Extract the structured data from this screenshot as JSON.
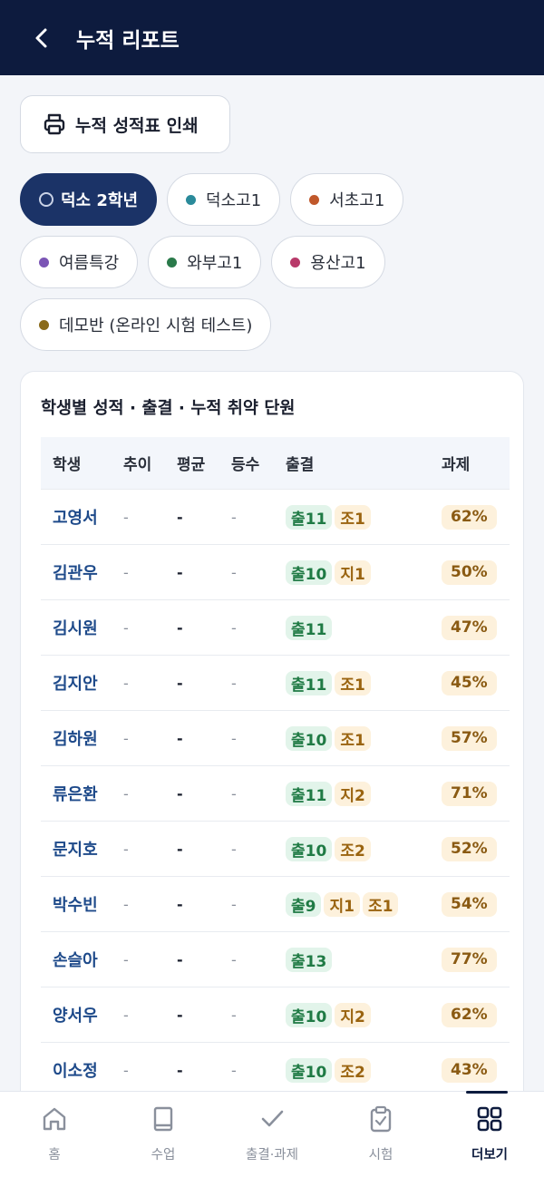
{
  "header": {
    "title": "누적 리포트"
  },
  "print_button": {
    "label": "누적 성적표 인쇄"
  },
  "classes": [
    {
      "label": "덕소 2학년",
      "active": true,
      "color": "#c9d2e6"
    },
    {
      "label": "덕소고1",
      "active": false,
      "color": "#2a8a9a"
    },
    {
      "label": "서초고1",
      "active": false,
      "color": "#c0582b"
    },
    {
      "label": "여름특강",
      "active": false,
      "color": "#7b55b5"
    },
    {
      "label": "와부고1",
      "active": false,
      "color": "#2a7a4a"
    },
    {
      "label": "용산고1",
      "active": false,
      "color": "#b83a6a"
    },
    {
      "label": "데모반 (온라인 시험 테스트)",
      "active": false,
      "color": "#8a6a1a"
    }
  ],
  "report": {
    "title": "학생별 성적 · 출결 · 누적 취약 단원",
    "columns": {
      "student": "학생",
      "trend": "추이",
      "avg": "평균",
      "rank": "등수",
      "attendance": "출결",
      "homework": "과제"
    },
    "rows": [
      {
        "name": "고영서",
        "trend": "-",
        "avg": "-",
        "rank": "-",
        "att": [
          "출11",
          "조1"
        ],
        "hw": "62%"
      },
      {
        "name": "김관우",
        "trend": "-",
        "avg": "-",
        "rank": "-",
        "att": [
          "출10",
          "지1"
        ],
        "hw": "50%"
      },
      {
        "name": "김시원",
        "trend": "-",
        "avg": "-",
        "rank": "-",
        "att": [
          "출11"
        ],
        "hw": "47%"
      },
      {
        "name": "김지안",
        "trend": "-",
        "avg": "-",
        "rank": "-",
        "att": [
          "출11",
          "조1"
        ],
        "hw": "45%"
      },
      {
        "name": "김하원",
        "trend": "-",
        "avg": "-",
        "rank": "-",
        "att": [
          "출10",
          "조1"
        ],
        "hw": "57%"
      },
      {
        "name": "류은환",
        "trend": "-",
        "avg": "-",
        "rank": "-",
        "att": [
          "출11",
          "지2"
        ],
        "hw": "71%"
      },
      {
        "name": "문지호",
        "trend": "-",
        "avg": "-",
        "rank": "-",
        "att": [
          "출10",
          "조2"
        ],
        "hw": "52%"
      },
      {
        "name": "박수빈",
        "trend": "-",
        "avg": "-",
        "rank": "-",
        "att": [
          "출9",
          "지1",
          "조1"
        ],
        "hw": "54%"
      },
      {
        "name": "손슬아",
        "trend": "-",
        "avg": "-",
        "rank": "-",
        "att": [
          "출13"
        ],
        "hw": "77%"
      },
      {
        "name": "양서우",
        "trend": "-",
        "avg": "-",
        "rank": "-",
        "att": [
          "출10",
          "지2"
        ],
        "hw": "62%"
      },
      {
        "name": "이소정",
        "trend": "-",
        "avg": "-",
        "rank": "-",
        "att": [
          "출10",
          "조2"
        ],
        "hw": "43%"
      }
    ]
  },
  "tabbar": [
    {
      "label": "홈",
      "icon": "home-icon",
      "active": false
    },
    {
      "label": "수업",
      "icon": "book-icon",
      "active": false
    },
    {
      "label": "출결·과제",
      "icon": "check-icon",
      "active": false
    },
    {
      "label": "시험",
      "icon": "clipboard-icon",
      "active": false
    },
    {
      "label": "더보기",
      "icon": "grid-icon",
      "active": true
    }
  ]
}
